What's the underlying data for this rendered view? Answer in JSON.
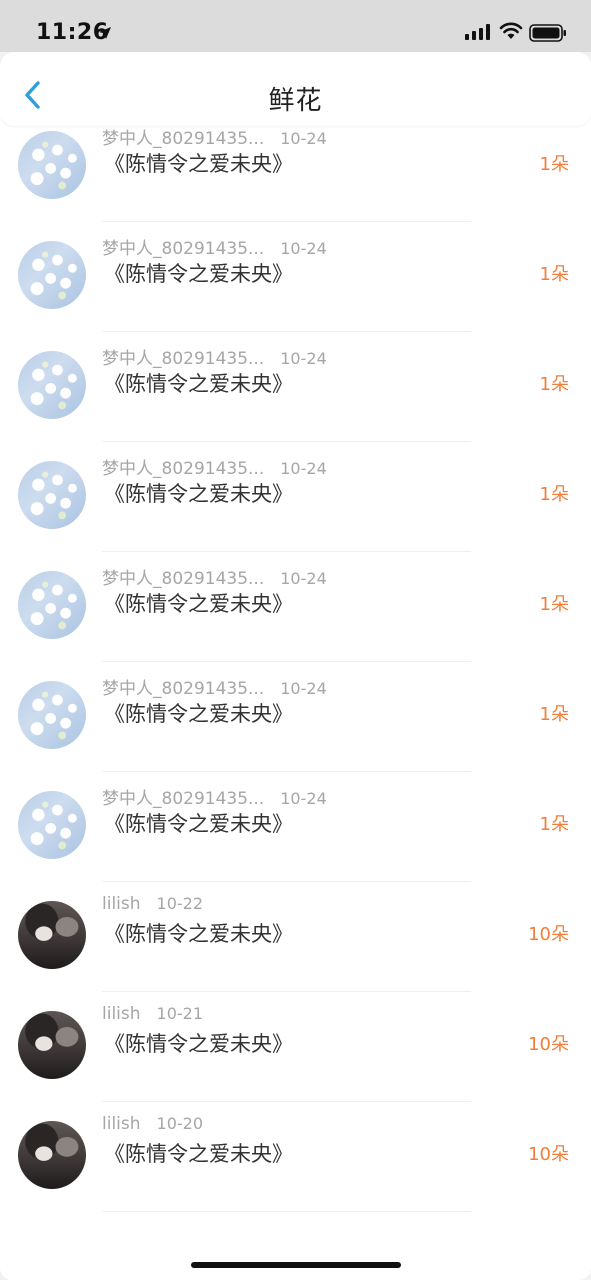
{
  "status_bar": {
    "time": "11:26",
    "icons": [
      "location-arrow-icon",
      "signal-icon",
      "wifi-icon",
      "battery-icon"
    ]
  },
  "nav": {
    "title": "鲜花",
    "back_icon": "chevron-left-icon",
    "accent_color": "#2b9fe0"
  },
  "colors": {
    "amount": "#ef7f3b",
    "meta": "#a6a6a6"
  },
  "rows": [
    {
      "user": "",
      "date": "",
      "book": "《陈情令之爱未央》",
      "amount": "1朵",
      "avatar": "flower-avatar"
    },
    {
      "user": "梦中人_80291435...",
      "date": "10-24",
      "book": "《陈情令之爱未央》",
      "amount": "1朵",
      "avatar": "flower-avatar"
    },
    {
      "user": "梦中人_80291435...",
      "date": "10-24",
      "book": "《陈情令之爱未央》",
      "amount": "1朵",
      "avatar": "flower-avatar"
    },
    {
      "user": "梦中人_80291435...",
      "date": "10-24",
      "book": "《陈情令之爱未央》",
      "amount": "1朵",
      "avatar": "flower-avatar"
    },
    {
      "user": "梦中人_80291435...",
      "date": "10-24",
      "book": "《陈情令之爱未央》",
      "amount": "1朵",
      "avatar": "flower-avatar"
    },
    {
      "user": "梦中人_80291435...",
      "date": "10-24",
      "book": "《陈情令之爱未央》",
      "amount": "1朵",
      "avatar": "flower-avatar"
    },
    {
      "user": "梦中人_80291435...",
      "date": "10-24",
      "book": "《陈情令之爱未央》",
      "amount": "1朵",
      "avatar": "flower-avatar"
    },
    {
      "user": "梦中人_80291435...",
      "date": "10-24",
      "book": "《陈情令之爱未央》",
      "amount": "1朵",
      "avatar": "flower-avatar"
    },
    {
      "user": "lilish",
      "date": "10-22",
      "book": "《陈情令之爱未央》",
      "amount": "10朵",
      "avatar": "person-avatar"
    },
    {
      "user": "lilish",
      "date": "10-21",
      "book": "《陈情令之爱未央》",
      "amount": "10朵",
      "avatar": "person-avatar"
    },
    {
      "user": "lilish",
      "date": "10-20",
      "book": "《陈情令之爱未央》",
      "amount": "10朵",
      "avatar": "person-avatar"
    }
  ]
}
